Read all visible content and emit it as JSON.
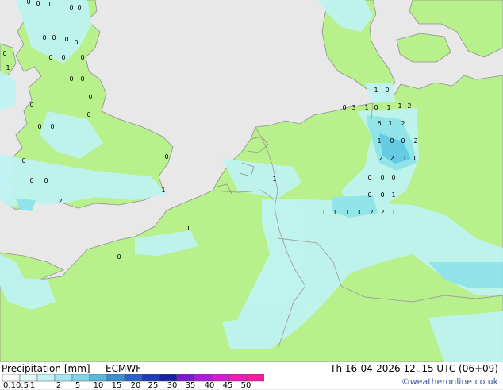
{
  "map": {
    "colors": {
      "sea": "#e8e8e8",
      "land": "#b8f08c",
      "border": "#a0a0a0",
      "coast": "#909090",
      "precip_light": "#bff4f4",
      "precip_medium": "#8ee3f0",
      "precip_heavy": "#5fc8ea"
    },
    "grid_values": [
      "0",
      "0",
      "0",
      "0",
      "0",
      "0",
      "0",
      "0",
      "0",
      "0",
      "0",
      "0",
      "0",
      "1",
      "0",
      "0",
      "0",
      "0",
      "0",
      "0",
      "0",
      "0",
      "0",
      "0",
      "0",
      "1",
      "2",
      "0",
      "0",
      "1",
      "0",
      "0",
      "3",
      "1",
      "0",
      "1",
      "1",
      "2",
      "6",
      "1",
      "2",
      "1",
      "0",
      "0",
      "2",
      "2",
      "2",
      "1",
      "0",
      "0",
      "0",
      "0",
      "0",
      "0",
      "1",
      "1",
      "1",
      "1",
      "3",
      "2",
      "2",
      "1",
      "1",
      "0"
    ]
  },
  "legend": {
    "title": "Precipitation [mm]",
    "model": "ECMWF",
    "ticks": [
      "0.1",
      "0.5",
      "1",
      "2",
      "5",
      "10",
      "15",
      "20",
      "25",
      "30",
      "35",
      "40",
      "45",
      "50"
    ],
    "colors": [
      "#ffffff",
      "#e3fafa",
      "#c4f2f5",
      "#a4e6f0",
      "#7fd3ea",
      "#5ab8e0",
      "#3c8fd4",
      "#2b62c8",
      "#1e3cb8",
      "#1622a0",
      "#7a1ad0",
      "#b01ad8",
      "#d81ad0",
      "#f01ab8",
      "#ff1aa0"
    ]
  },
  "valid_time": "Th 16-04-2026 12..15 UTC (06+09)",
  "credit": "©weatheronline.co.uk"
}
